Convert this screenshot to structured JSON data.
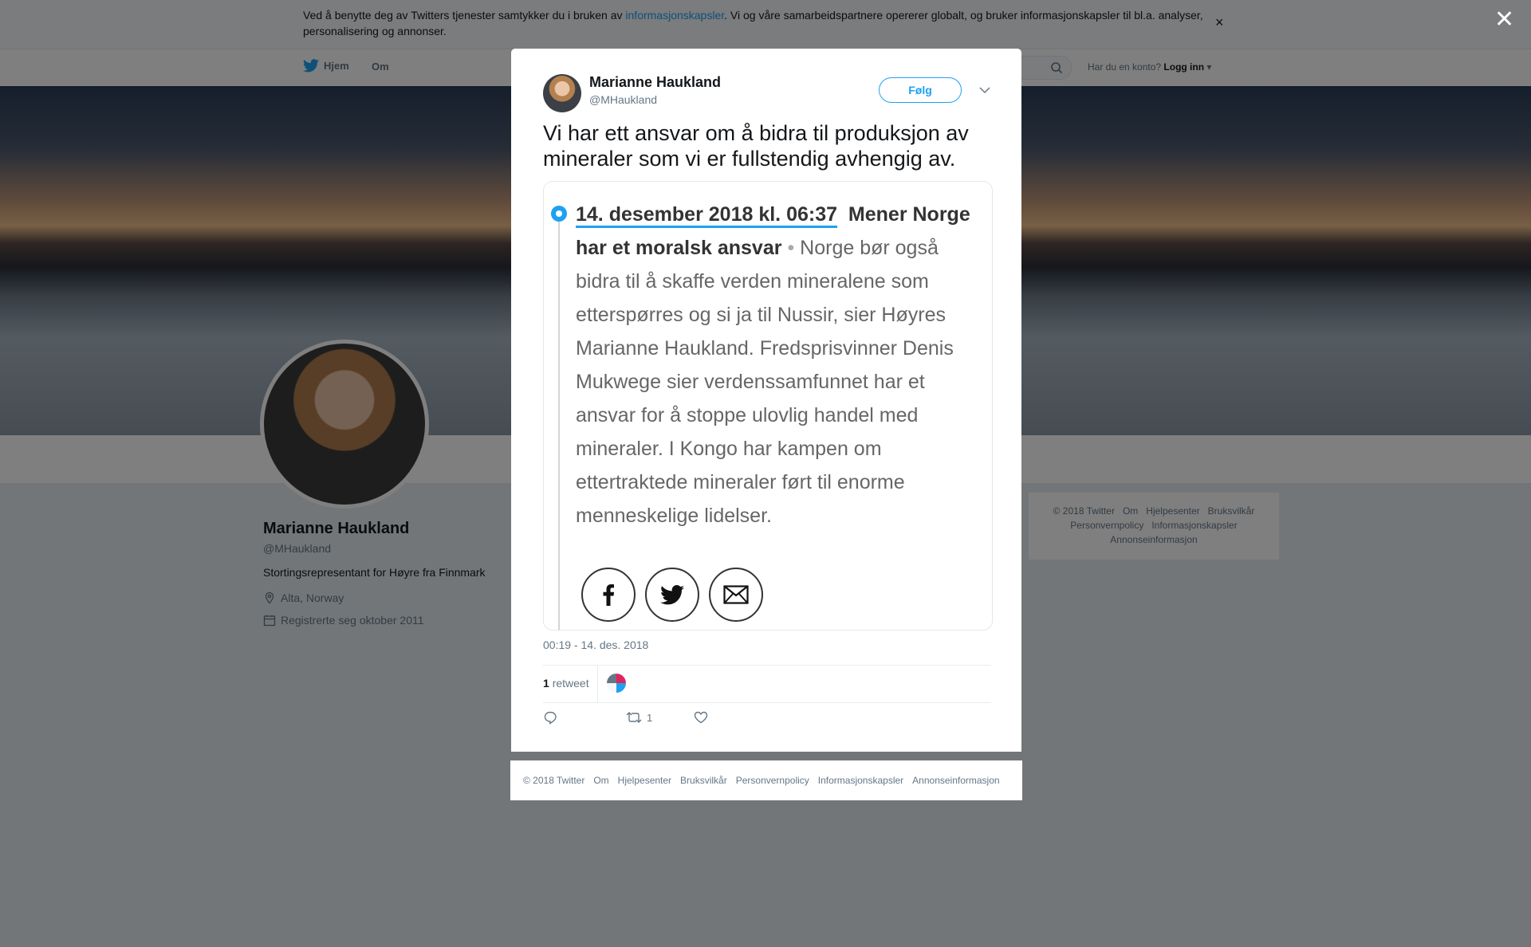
{
  "cookie": {
    "text_before": "Ved å benytte deg av Twitters tjenester samtykker du i bruken av ",
    "link": "informasjonskapsler",
    "text_after": ". Vi og våre samarbeidspartnere opererer globalt, og bruker informasjonskapsler til bl.a. analyser, personalisering og annonser.",
    "close": "×"
  },
  "nav": {
    "home": "Hjem",
    "about": "Om",
    "account_prompt": "Har du en konto?",
    "login": "Logg inn"
  },
  "profile": {
    "name": "Marianne Haukland",
    "handle": "@MHaukland",
    "bio": "Stortingsrepresentant for Høyre fra Finnmark",
    "location": "Alta, Norway",
    "joined": "Registrerte seg oktober 2011"
  },
  "side_footer": {
    "copyright": "© 2018 Twitter",
    "about": "Om",
    "help": "Hjelpesenter",
    "terms": "Bruksvilkår",
    "privacy": "Personvernpolicy",
    "cookies": "Informasjonskapsler",
    "ads": "Annonseinformasjon"
  },
  "overlay": {
    "close": "✕"
  },
  "tweet": {
    "name": "Marianne Haukland",
    "handle": "@MHaukland",
    "follow": "Følg",
    "text": "Vi har ett ansvar om å bidra til produksjon av mineraler som vi er fullstendig avhengig av.",
    "card": {
      "date": "14. desember 2018 kl. 06:37",
      "headline": "Mener Norge har et moralsk ansvar",
      "bullet": "•",
      "body": "Norge bør også bidra til å skaffe verden mineralene som etterspørres og si ja til Nussir, sier Høyres Marianne Haukland. Fredsprisvinner Denis Mukwege sier verdenssamfunnet har et ansvar for å stoppe ulovlig handel med mineraler. I Kongo har kampen om ettertraktede mineraler ført til enorme menneskelige lidelser."
    },
    "timestamp": "00:19 - 14. des. 2018",
    "retweet_count": "1",
    "retweet_label": "retweet",
    "action_retweet_count": "1"
  },
  "modal_footer": {
    "copyright": "© 2018 Twitter",
    "about": "Om",
    "help": "Hjelpesenter",
    "terms": "Bruksvilkår",
    "privacy": "Personvernpolicy",
    "cookies": "Informasjonskapsler",
    "ads": "Annonseinformasjon"
  },
  "colors": {
    "accent": "#1da1f2",
    "overlay": "rgba(0,0,0,0.5)"
  }
}
